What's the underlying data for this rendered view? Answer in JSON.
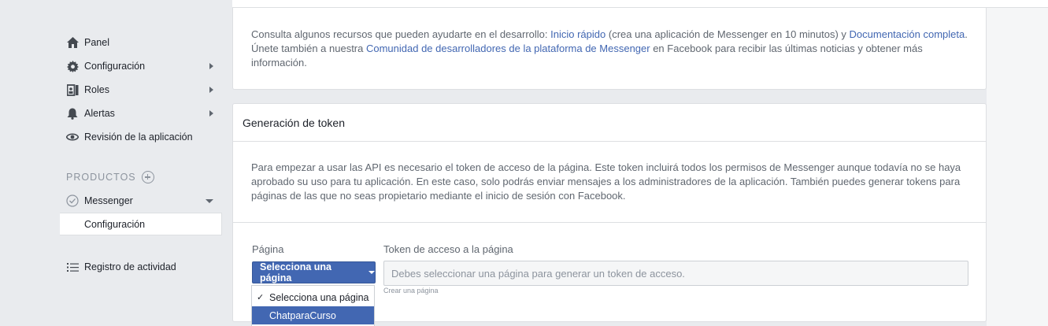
{
  "sidebar": {
    "items": [
      {
        "label": "Panel",
        "icon": "home-icon"
      },
      {
        "label": "Configuración",
        "icon": "gear-icon"
      },
      {
        "label": "Roles",
        "icon": "roles-icon"
      },
      {
        "label": "Alertas",
        "icon": "bell-icon"
      },
      {
        "label": "Revisión de la aplicación",
        "icon": "eye-icon"
      }
    ],
    "products_label": "PRODUCTOS",
    "messenger_label": "Messenger",
    "messenger_sub": "Configuración",
    "activity_label": "Registro de actividad"
  },
  "resources": {
    "t1": "Consulta algunos recursos que pueden ayudarte en el desarrollo: ",
    "link1": "Inicio rápido",
    "t2": " (crea una aplicación de Messenger en 10 minutos) y ",
    "link2": "Documentación completa",
    "t3": ". Únete también a nuestra ",
    "link3": "Comunidad de desarrolladores de la plataforma de Messenger",
    "t4": " en Facebook para recibir las últimas noticias y obtener más información."
  },
  "token": {
    "title": "Generación de token",
    "description": "Para empezar a usar las API es necesario el token de acceso de la página. Este token incluirá todos los permisos de Messenger aunque todavía no se haya aprobado su uso para tu aplicación. En este caso, solo podrás enviar mensajes a los administradores de la aplicación. También puedes generar tokens para páginas de las que no seas propietario mediante el inicio de sesión con Facebook.",
    "page_label": "Página",
    "token_label": "Token de acceso a la página",
    "select_label": "Selecciona una página",
    "input_placeholder": "Debes seleccionar una página para generar un token de acceso.",
    "create_link": "Crear una página"
  },
  "dropdown": {
    "options": [
      "Selecciona una página",
      "ChatparaCurso"
    ],
    "selected": "Selecciona una página",
    "highlighted": "ChatparaCurso"
  },
  "colors": {
    "accent": "#4267b2",
    "background": "#e9ebee",
    "text_secondary": "#606770"
  }
}
